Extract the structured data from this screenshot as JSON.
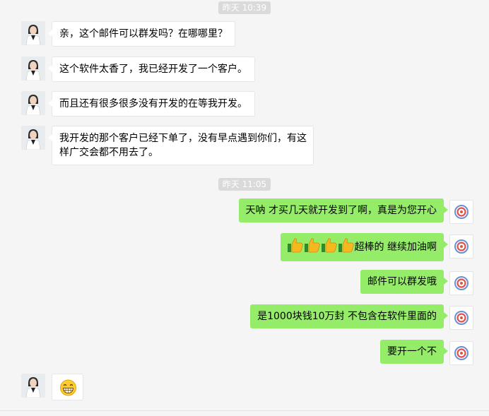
{
  "timestamps": [
    "昨天 10:39",
    "昨天 11:05"
  ],
  "messages": {
    "m1": "亲，这个邮件可以群发吗？在哪哪里？",
    "m2": "这个软件太香了，我已经开发了一个客户。",
    "m3": "而且还有很多很多没有开发的在等我开发。",
    "m4_line1": "我开发的那个客户已经下单了，没有早点遇到你们，有这",
    "m4_line2": "样广交会都不用去了。",
    "m5": "天呐 才买几天就开发到了啊，真是为您开心",
    "m6": "超棒的 继续加油啊",
    "m7": "邮件可以群发哦",
    "m8": "是1000块钱10万封  不包含在软件里面的",
    "m9": "要开一个不"
  },
  "icons": {
    "avatar_left": "woman-doctor-avatar",
    "avatar_right": "red-blue-logo-avatar",
    "thumbs": "thumbs-up-icon",
    "grin": "grinning-face-icon"
  },
  "colors": {
    "outgoing_bubble": "#95ec69",
    "incoming_bubble": "#ffffff",
    "background": "#f5f5f5"
  }
}
